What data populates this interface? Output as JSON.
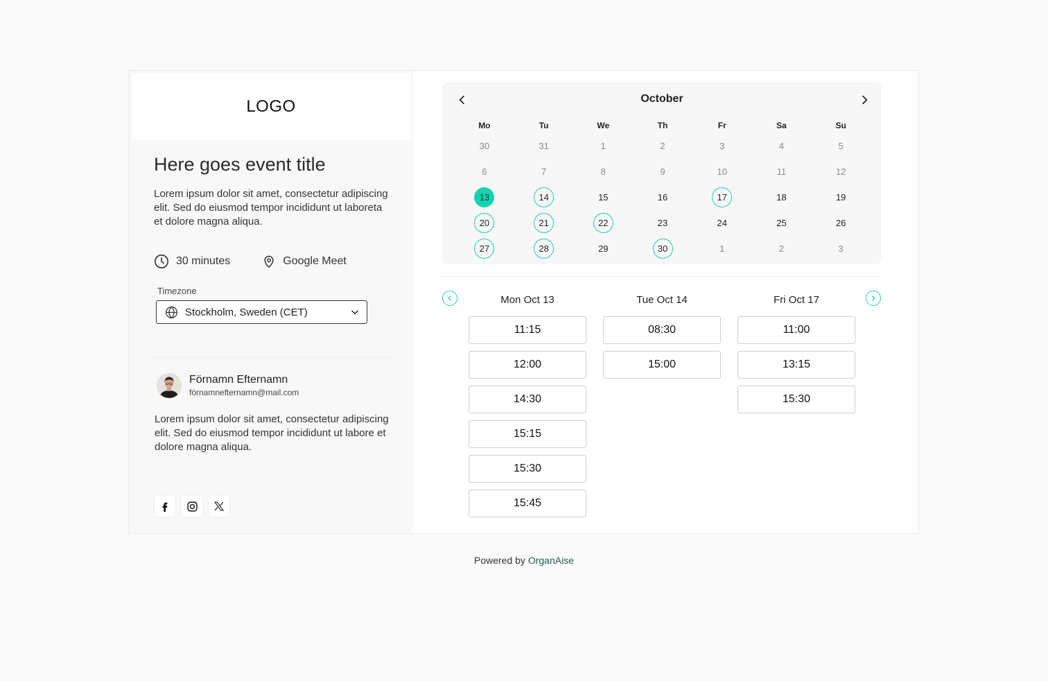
{
  "logo": "LOGO",
  "event": {
    "title": "Here goes event title",
    "description": "Lorem ipsum dolor sit amet, consectetur adipiscing elit. Sed do eiusmod tempor incididunt ut laboreta et dolore magna aliqua.",
    "duration": "30 minutes",
    "location": "Google Meet"
  },
  "timezone": {
    "label": "Timezone",
    "value": "Stockholm, Sweden (CET)"
  },
  "host": {
    "name": "Förnamn Efternamn",
    "email": "förnamnefternamn@mail.com",
    "bio": "Lorem ipsum dolor sit amet, consectetur adipiscing elit. Sed do eiusmod tempor incididunt ut labore et dolore magna aliqua."
  },
  "socials": [
    "facebook-icon",
    "instagram-icon",
    "x-icon"
  ],
  "calendar": {
    "month": "October",
    "weekdays": [
      "Mo",
      "Tu",
      "We",
      "Th",
      "Fr",
      "Sa",
      "Su"
    ],
    "weeks": [
      [
        {
          "d": "30",
          "s": "muted"
        },
        {
          "d": "31",
          "s": "muted"
        },
        {
          "d": "1",
          "s": "muted"
        },
        {
          "d": "2",
          "s": "muted"
        },
        {
          "d": "3",
          "s": "muted"
        },
        {
          "d": "4",
          "s": "muted"
        },
        {
          "d": "5",
          "s": "muted"
        }
      ],
      [
        {
          "d": "6",
          "s": "muted"
        },
        {
          "d": "7",
          "s": "muted"
        },
        {
          "d": "8",
          "s": "muted"
        },
        {
          "d": "9",
          "s": "muted"
        },
        {
          "d": "10",
          "s": "muted"
        },
        {
          "d": "11",
          "s": "muted"
        },
        {
          "d": "12",
          "s": "muted"
        }
      ],
      [
        {
          "d": "13",
          "s": "selected"
        },
        {
          "d": "14",
          "s": "avail"
        },
        {
          "d": "15",
          "s": ""
        },
        {
          "d": "16",
          "s": ""
        },
        {
          "d": "17",
          "s": "avail"
        },
        {
          "d": "18",
          "s": ""
        },
        {
          "d": "19",
          "s": ""
        }
      ],
      [
        {
          "d": "20",
          "s": "avail"
        },
        {
          "d": "21",
          "s": "avail"
        },
        {
          "d": "22",
          "s": "avail"
        },
        {
          "d": "23",
          "s": ""
        },
        {
          "d": "24",
          "s": ""
        },
        {
          "d": "25",
          "s": ""
        },
        {
          "d": "26",
          "s": ""
        }
      ],
      [
        {
          "d": "27",
          "s": "avail"
        },
        {
          "d": "28",
          "s": "avail"
        },
        {
          "d": "29",
          "s": ""
        },
        {
          "d": "30",
          "s": "avail"
        },
        {
          "d": "1",
          "s": "muted"
        },
        {
          "d": "2",
          "s": "muted"
        },
        {
          "d": "3",
          "s": "muted"
        }
      ]
    ]
  },
  "slots": [
    {
      "day": "Mon Oct 13",
      "times": [
        "11:15",
        "12:00",
        "14:30",
        "15:15",
        "15:30",
        "15:45"
      ]
    },
    {
      "day": "Tue Oct 14",
      "times": [
        "08:30",
        "15:00"
      ]
    },
    {
      "day": "Fri Oct 17",
      "times": [
        "11:00",
        "13:15",
        "15:30"
      ]
    }
  ],
  "footer": {
    "prefix": "Powered by ",
    "brand": "OrganAise"
  },
  "colors": {
    "accent": "#12d4ae",
    "accent_border": "#1fcfb0",
    "brand_text": "#1d5e4f"
  }
}
